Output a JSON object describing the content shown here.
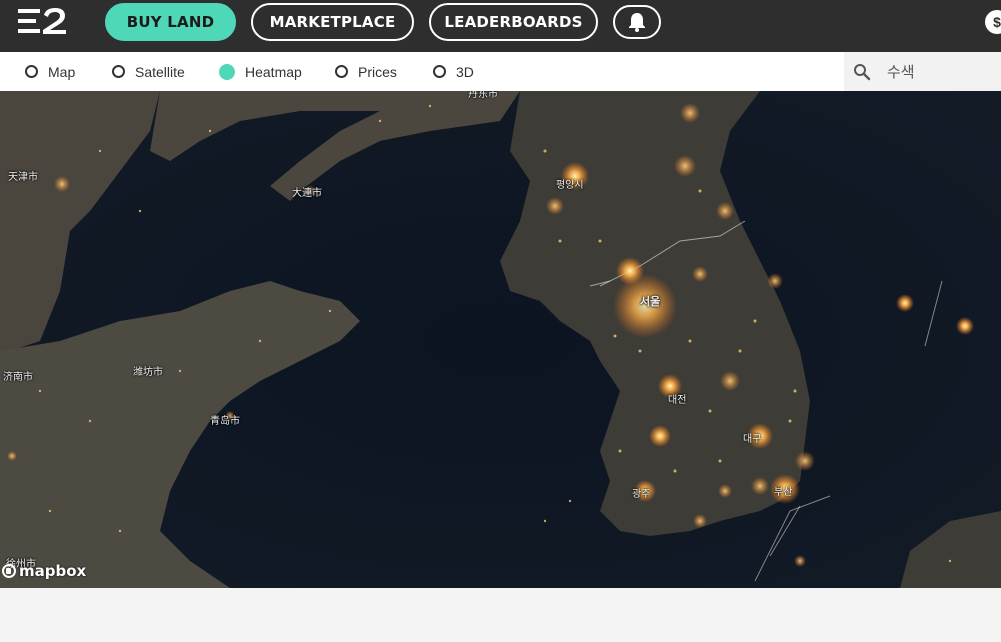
{
  "nav": {
    "buy_land": "BUY LAND",
    "marketplace": "MARKETPLACE",
    "leaderboards": "LEADERBOARDS",
    "bell_icon": "bell-icon",
    "currency_symbol": "$"
  },
  "view_modes": [
    {
      "label": "Map",
      "selected": false
    },
    {
      "label": "Satellite",
      "selected": false
    },
    {
      "label": "Heatmap",
      "selected": true
    },
    {
      "label": "Prices",
      "selected": false
    },
    {
      "label": "3D",
      "selected": false
    }
  ],
  "search": {
    "placeholder": "수색"
  },
  "map": {
    "labels": {
      "tianjin": "天津市",
      "dalian": "大連市",
      "pyongyang": "평양시",
      "seoul": "서울",
      "weifang": "潍坊市",
      "jinan": "济南市",
      "qingdao": "青岛市",
      "daejeon": "대전",
      "daegu": "대구",
      "gwangju": "광주",
      "busan": "부산",
      "xuzhou": "徐州市",
      "top_cut": "丹东市"
    },
    "attribution": "mapbox"
  },
  "colors": {
    "accent": "#4fd8b8",
    "topbar": "#2e2e2e",
    "heat_glow": "#ff9a2e"
  }
}
